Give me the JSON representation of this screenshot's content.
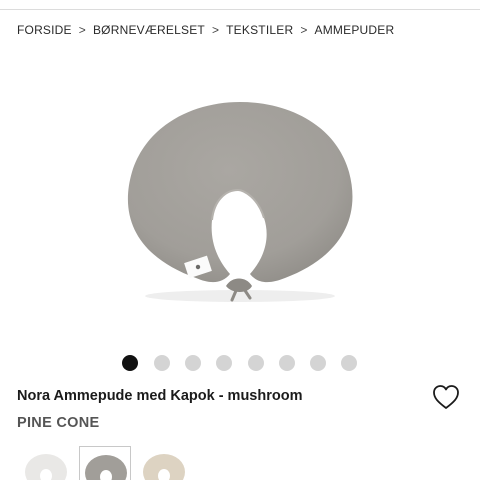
{
  "breadcrumb": {
    "items": [
      {
        "label": "FORSIDE"
      },
      {
        "label": "BØRNEVÆRELSET"
      },
      {
        "label": "TEKSTILER"
      },
      {
        "label": "AMMEPUDER"
      }
    ],
    "separator": ">"
  },
  "gallery": {
    "image_alt": "Nora Ammepude med Kapok - mushroom",
    "pillow_color": "#a19e99",
    "image_count": 8,
    "active_index": 0
  },
  "product": {
    "title": "Nora Ammepude med Kapok - mushroom",
    "brand": "PINE CONE"
  },
  "icons": {
    "wishlist": "heart-outline-icon"
  },
  "variants": [
    {
      "name": "white",
      "color": "#e9e8e6",
      "selected": false
    },
    {
      "name": "mushroom",
      "color": "#a19e99",
      "selected": true
    },
    {
      "name": "sand",
      "color": "#ddd3c2",
      "selected": false
    }
  ],
  "colors": {
    "dot_active": "#111111",
    "dot_inactive": "#d4d4d4",
    "text_primary": "#1b1b1b",
    "text_brand": "#555555"
  }
}
